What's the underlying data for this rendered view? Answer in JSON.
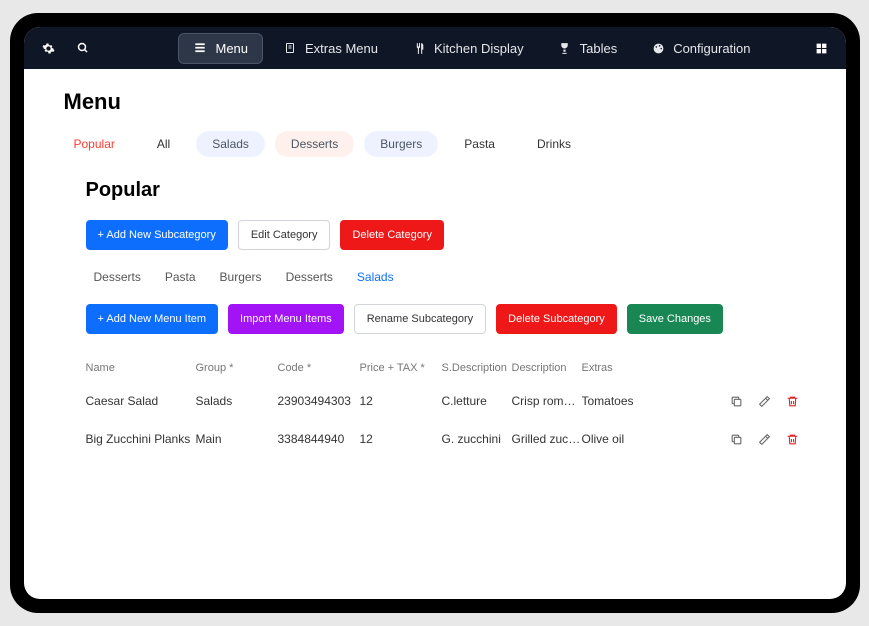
{
  "nav": {
    "items": [
      {
        "id": "menu",
        "label": "Menu",
        "active": true
      },
      {
        "id": "extras",
        "label": "Extras Menu",
        "active": false
      },
      {
        "id": "kitchen",
        "label": "Kitchen Display",
        "active": false
      },
      {
        "id": "tables",
        "label": "Tables",
        "active": false
      },
      {
        "id": "config",
        "label": "Configuration",
        "active": false
      }
    ]
  },
  "page": {
    "title": "Menu"
  },
  "categoryTabs": [
    {
      "id": "popular",
      "label": "Popular",
      "style": "popular"
    },
    {
      "id": "all",
      "label": "All",
      "style": "plain"
    },
    {
      "id": "salads",
      "label": "Salads",
      "style": "pill"
    },
    {
      "id": "desserts",
      "label": "Desserts",
      "style": "pill-pink"
    },
    {
      "id": "burgers",
      "label": "Burgers",
      "style": "pill"
    },
    {
      "id": "pasta",
      "label": "Pasta",
      "style": "plain"
    },
    {
      "id": "drinks",
      "label": "Drinks",
      "style": "plain"
    }
  ],
  "section": {
    "title": "Popular",
    "categoryButtons": {
      "addSubcategory": "+ Add New Subcategory",
      "editCategory": "Edit Category",
      "deleteCategory": "Delete Category"
    },
    "subTabs": [
      {
        "id": "desserts",
        "label": "Desserts",
        "active": false
      },
      {
        "id": "pasta",
        "label": "Pasta",
        "active": false
      },
      {
        "id": "burgers",
        "label": "Burgers",
        "active": false
      },
      {
        "id": "desserts2",
        "label": "Desserts",
        "active": false
      },
      {
        "id": "salads",
        "label": "Salads",
        "active": true
      }
    ],
    "itemButtons": {
      "addItem": "+ Add New Menu Item",
      "importItems": "Import Menu Items",
      "renameSub": "Rename Subcategory",
      "deleteSub": "Delete Subcategory",
      "save": "Save Changes"
    }
  },
  "table": {
    "headers": {
      "name": "Name",
      "group": "Group *",
      "code": "Code *",
      "price": "Price + TAX *",
      "sdesc": "S.Description",
      "desc": "Description",
      "extras": "Extras"
    },
    "rows": [
      {
        "name": "Caesar Salad",
        "group": "Salads",
        "code": "23903494303",
        "price": "12",
        "sdesc": "C.letture",
        "desc": "Crisp romain..",
        "extras": "Tomatoes"
      },
      {
        "name": "Big Zucchini Planks",
        "group": "Main",
        "code": "3384844940",
        "price": "12",
        "sdesc": "G. zucchini",
        "desc": "Grilled zucch..",
        "extras": "Olive oil"
      }
    ]
  }
}
